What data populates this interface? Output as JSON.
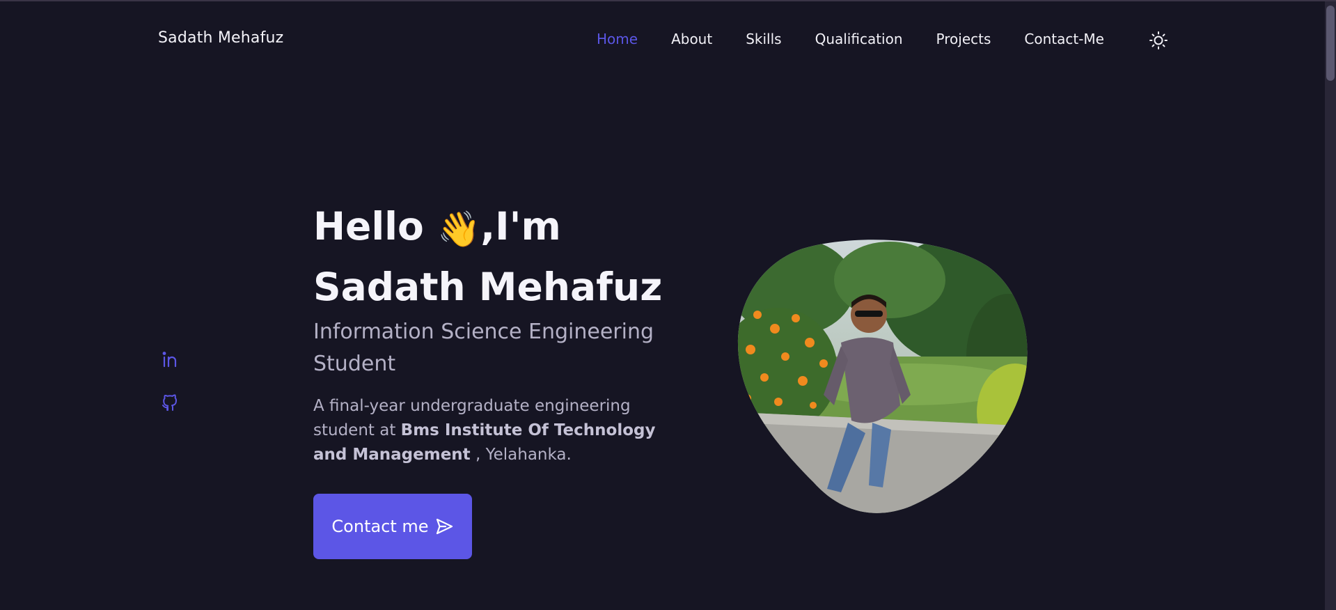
{
  "header": {
    "brand": "Sadath Mehafuz",
    "nav": [
      "Home",
      "About",
      "Skills",
      "Qualification",
      "Projects",
      "Contact-Me"
    ],
    "active": "Home",
    "theme_icon": "sun-icon"
  },
  "social": {
    "icons": [
      "linkedin-icon",
      "github-icon"
    ]
  },
  "hero": {
    "greeting_prefix": "Hello",
    "greeting_suffix": ",I'm",
    "name": "Sadath Mehafuz",
    "subtitle": "Information Science Engineering Student",
    "desc_part1": "A final-year undergraduate engineering student at",
    "desc_bold": "Bms Institute Of Technology and Management",
    "desc_part2": ", Yelahanka.",
    "cta_label": "Contact me"
  },
  "colors": {
    "background": "#161523",
    "accent": "#5c56e6",
    "text": "#f5f4fa",
    "muted": "#b4b1c6"
  }
}
